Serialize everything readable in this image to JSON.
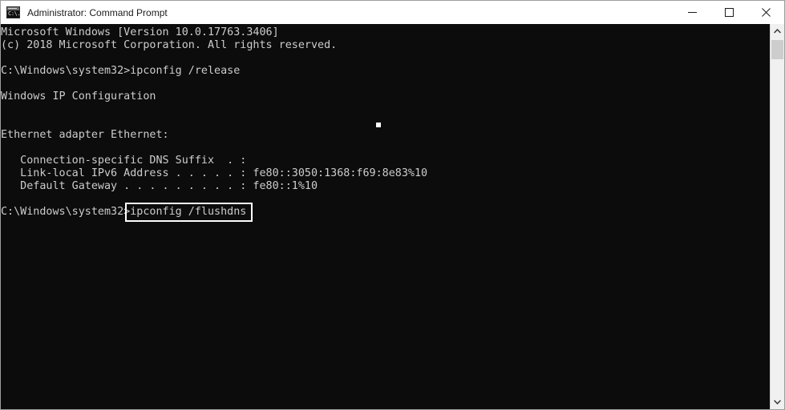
{
  "window": {
    "title": "Administrator: Command Prompt",
    "icon_name": "command-prompt-icon",
    "icon_text": "C:\\.",
    "background_color": "#0c0c0c",
    "text_color": "#cccccc",
    "titlebar_color": "#ffffff"
  },
  "window_controls": {
    "minimize_label": "Minimize",
    "maximize_label": "Maximize",
    "close_label": "Close"
  },
  "console": {
    "lines": [
      "Microsoft Windows [Version 10.0.17763.3406]",
      "(c) 2018 Microsoft Corporation. All rights reserved.",
      "",
      "C:\\Windows\\system32>ipconfig /release",
      "",
      "Windows IP Configuration",
      "",
      "",
      "Ethernet adapter Ethernet:",
      "",
      "   Connection-specific DNS Suffix  . :",
      "   Link-local IPv6 Address . . . . . : fe80::3050:1368:f69:8e83%10",
      "   Default Gateway . . . . . . . . . : fe80::1%10",
      "",
      "C:\\Windows\\system32>ipconfig /flushdns"
    ],
    "prompt_path": "C:\\Windows\\system32",
    "command_released": "ipconfig /release",
    "command_highlighted": "ipconfig /flushdns",
    "ipv6_address": "fe80::3050:1368:f69:8e83%10",
    "default_gateway": "fe80::1%10",
    "dns_suffix": "",
    "adapter": "Ethernet adapter Ethernet:",
    "highlight_color": "#ffffff"
  },
  "scrollbar": {
    "up_arrow": "∧",
    "down_arrow": "∨",
    "thumb_color": "#cdcdcd",
    "track_color": "#f0f0f0"
  }
}
